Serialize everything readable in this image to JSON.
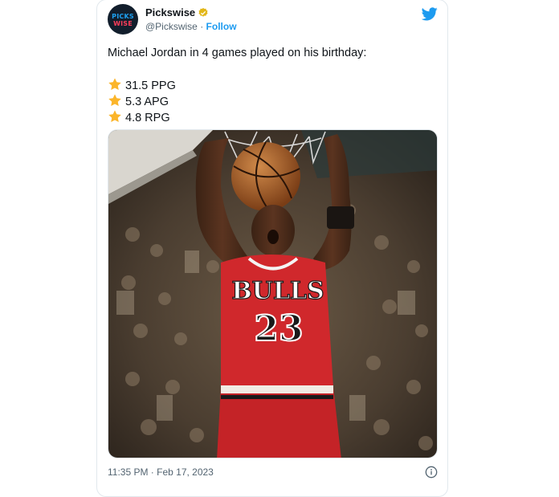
{
  "tweet": {
    "avatar": {
      "line1": "PICKS",
      "line2": "WISE"
    },
    "display_name": "Pickswise",
    "handle": "@Pickswise",
    "separator": " · ",
    "follow_label": "Follow",
    "text_line1": "Michael Jordan in 4 games played on his birthday:",
    "stats": [
      {
        "icon": "star-emoji-icon",
        "text": "31.5 PPG"
      },
      {
        "icon": "star-emoji-icon",
        "text": "5.3 APG"
      },
      {
        "icon": "star-emoji-icon",
        "text": "4.8 RPG"
      }
    ],
    "jersey": {
      "team": "BULLS",
      "number": "23"
    },
    "timestamp": "11:35 PM · Feb 17, 2023"
  },
  "colors": {
    "brand_blue": "#1d9bf0",
    "text": "#0f1419",
    "muted": "#536471",
    "verified_gold": "#e2b719",
    "jersey_red": "#d0282c"
  }
}
